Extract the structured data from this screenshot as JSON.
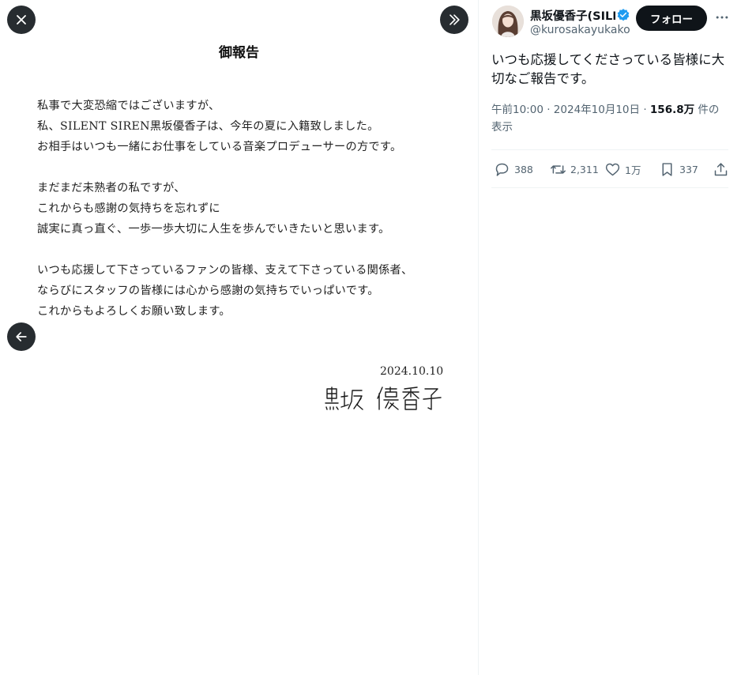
{
  "viewer": {
    "doc_title": "御報告",
    "paragraphs": [
      [
        "私事で大変恐縮ではございますが、",
        "私、SILENT SIREN黒坂優香子は、今年の夏に入籍致しました。",
        "お相手はいつも一緒にお仕事をしている音楽プロデューサーの方です。"
      ],
      [
        "まだまだ未熟者の私ですが、",
        "これからも感謝の気持ちを忘れずに",
        "誠実に真っ直ぐ、一歩一歩大切に人生を歩んでいきたいと思います。"
      ],
      [
        "いつも応援して下さっているファンの皆様、支えて下さっている関係者、",
        "ならびにスタッフの皆様には心から感謝の気持ちでいっぱいです。",
        "これからもよろしくお願い致します。"
      ]
    ],
    "date": "2024.10.10",
    "signature": "黒坂 優香子"
  },
  "icons": {
    "close": "close-icon",
    "next": "double-chevron-right-icon",
    "back": "arrow-left-icon",
    "verified": "verified-badge-icon",
    "more": "more-horizontal-icon",
    "reply": "reply-icon",
    "repost": "repost-icon",
    "like": "heart-icon",
    "bookmark": "bookmark-icon",
    "share": "share-icon"
  },
  "tweet": {
    "display_name": "黒坂優香子(SILENT SIREN)",
    "handle": "@kurosakayukako",
    "follow_label": "フォロー",
    "text": "いつも応援してくださっている皆様に大切なご報告です。",
    "time": "午前10:00",
    "date": "2024年10月10日",
    "views_count": "156.8万",
    "views_label": "件の表示",
    "sep": "·",
    "counts": {
      "reply": "388",
      "repost": "2,311",
      "like": "1万",
      "bookmark": "337"
    }
  },
  "colors": {
    "accent": "#1d9bf0",
    "dark": "#0f1419",
    "muted": "#536471"
  }
}
